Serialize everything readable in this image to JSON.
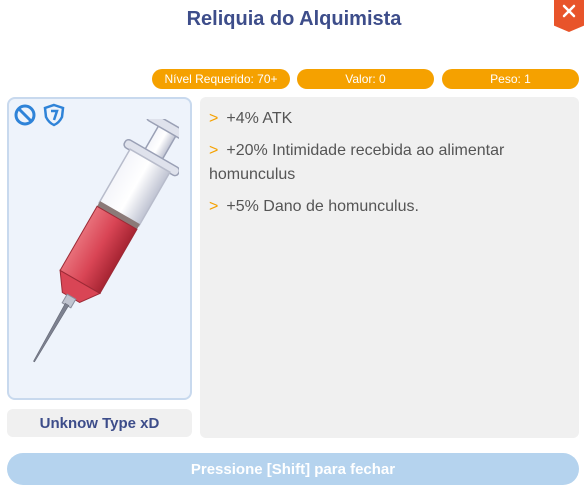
{
  "window": {
    "title": "Reliquia do Alquimista"
  },
  "badges": {
    "level": "Nível Requerido: 70+",
    "value": "Valor: 0",
    "weight": "Peso: 1"
  },
  "icons": [
    "no-sign-icon",
    "shield-icon",
    "syringe-icon",
    "close-icon"
  ],
  "item": {
    "type": "Unknow Type xD"
  },
  "description": [
    {
      "marker": ">",
      "text": "+4% ATK"
    },
    {
      "marker": ">",
      "text": "+20% Intimidade recebida ao alimentar homunculus"
    },
    {
      "marker": ">",
      "text": "+5% Dano de homunculus."
    }
  ],
  "footer": {
    "label": "Pressione [Shift] para fechar"
  },
  "colors": {
    "accent": "#f5a100",
    "title": "#3d4d8a",
    "close": "#e8542a",
    "footer": "#b5d3ee"
  }
}
